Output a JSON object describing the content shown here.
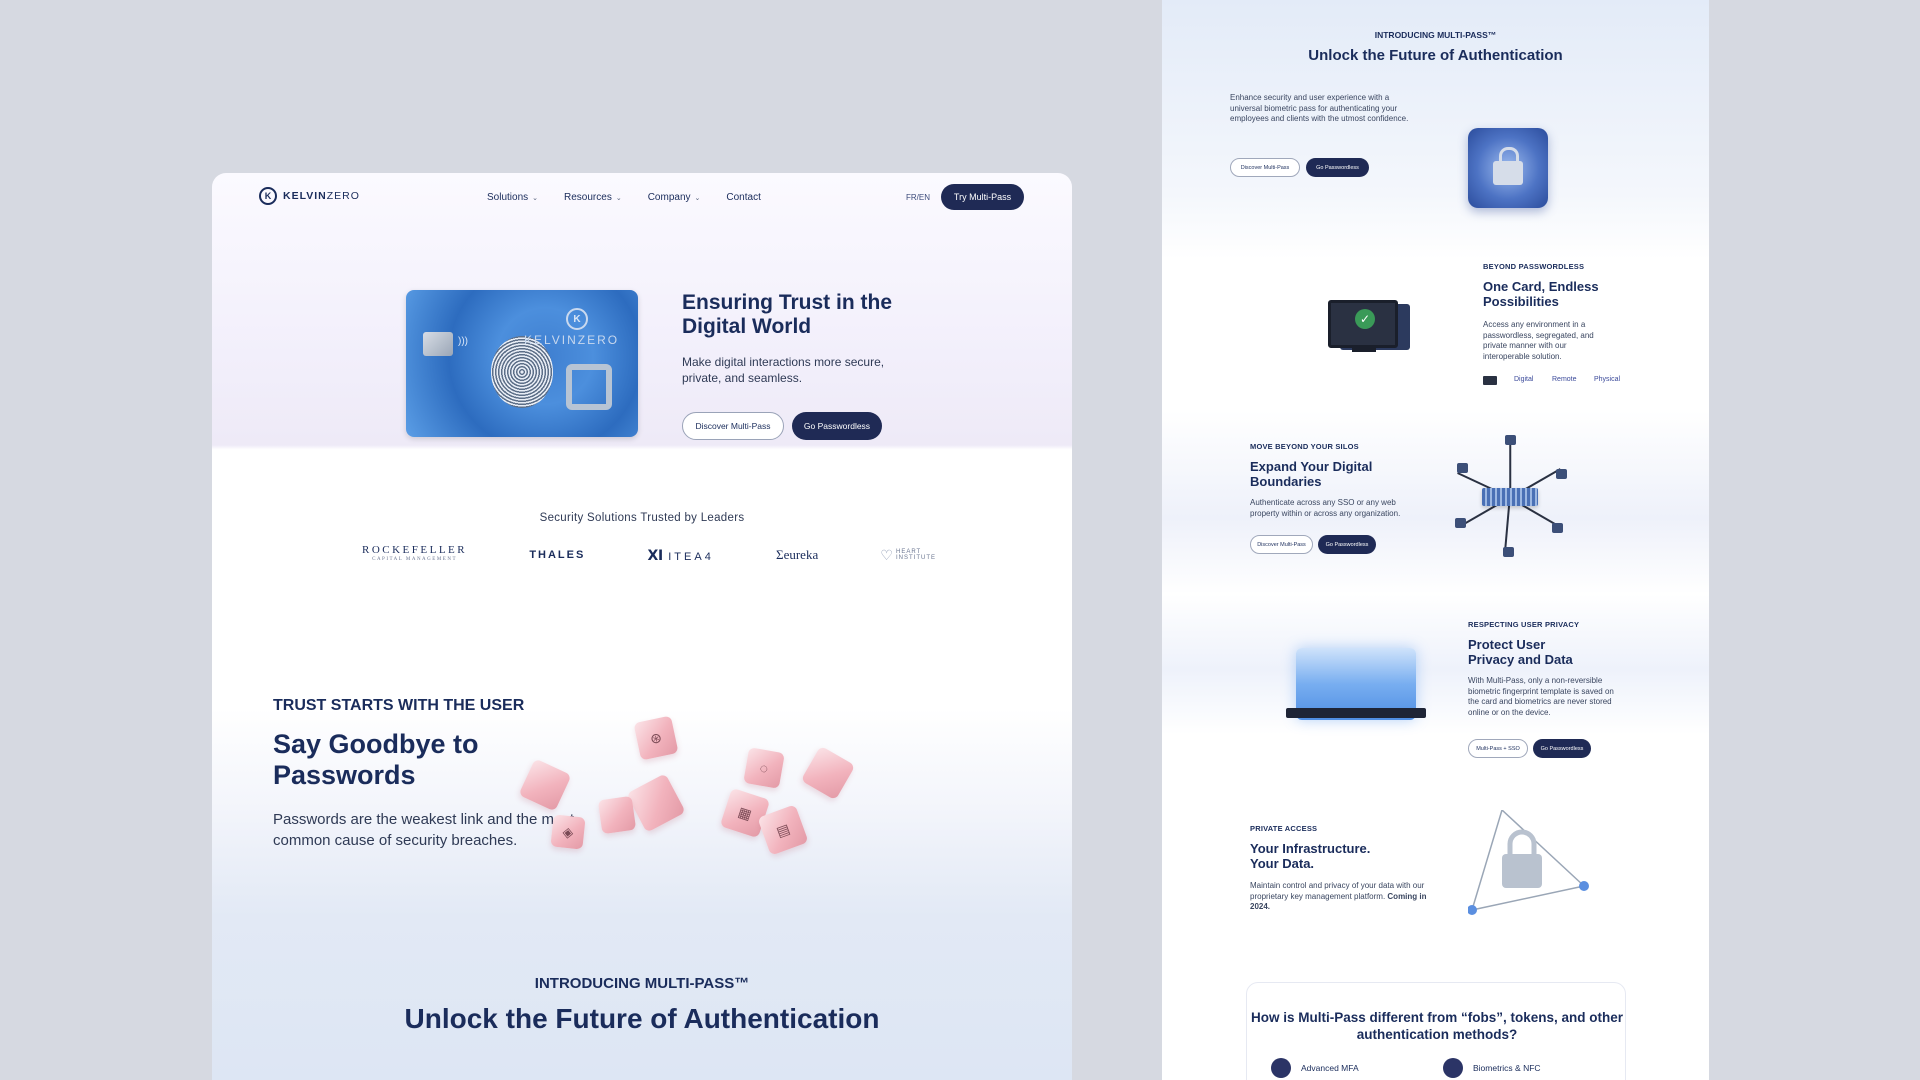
{
  "left": {
    "nav": {
      "logo_k": "K",
      "logo_bold": "KELVIN",
      "logo_light": "ZERO",
      "links": [
        "Solutions",
        "Resources",
        "Company",
        "Contact"
      ],
      "lang": "FR/EN",
      "cta": "Try Multi-Pass"
    },
    "hero": {
      "card_brand": "KELVINZERO",
      "title": "Ensuring Trust in the Digital World",
      "subtitle": "Make digital interactions more secure, private, and seamless.",
      "btn_outline": "Discover Multi-Pass",
      "btn_dark": "Go Passwordless"
    },
    "trusted": {
      "heading": "Security Solutions Trusted by Leaders",
      "logos": [
        "ROCKEFELLER",
        "THALES",
        "ITEA4",
        "Σeureka",
        "HEART INSTITUTE"
      ],
      "rock_sub": "CAPITAL MANAGEMENT"
    },
    "passwords": {
      "eyebrow": "TRUST STARTS WITH THE USER",
      "title": "Say Goodbye to Passwords",
      "subtitle": "Passwords are the weakest link and the most common cause of security breaches."
    },
    "intro": {
      "eyebrow": "INTRODUCING MULTI-PASS™",
      "title": "Unlock the Future of Authentication"
    }
  },
  "right": {
    "eyebrow": "INTRODUCING MULTI-PASS™",
    "title": "Unlock the Future of Authentication",
    "intro_text": "Enhance security and user experience with a universal biometric pass for authenticating your employees and clients with the utmost confidence.",
    "intro_btn_outline": "Discover Multi-Pass",
    "intro_btn_dark": "Go Passwordless",
    "s1": {
      "kicker": "BEYOND PASSWORDLESS",
      "title": "One Card, Endless Possibilities",
      "text": "Access any environment in a passwordless, segregated, and private manner with our interoperable solution.",
      "options": [
        "Digital",
        "Remote",
        "Physical"
      ]
    },
    "s2": {
      "kicker": "MOVE BEYOND YOUR SILOS",
      "title": "Expand Your Digital Boundaries",
      "text": "Authenticate across any SSO or any web property within or across any organization.",
      "btn_outline": "Discover Multi-Pass",
      "btn_dark": "Go Passwordless"
    },
    "s3": {
      "kicker": "RESPECTING USER PRIVACY",
      "title": "Protect User Privacy and Data",
      "text": "With Multi-Pass, only a non-reversible biometric fingerprint template is saved on the card and biometrics are never stored online or on the device.",
      "btn_outline": "Multi-Pass + SSO",
      "btn_dark": "Go Passwordless"
    },
    "s4": {
      "kicker": "PRIVATE ACCESS",
      "title": "Your Infrastructure. Your Data.",
      "text": "Maintain control and privacy of your data with our proprietary key management platform.",
      "text_bold": "Coming in 2024."
    },
    "faq": {
      "title": "How is Multi-Pass different from “fobs”, tokens, and other authentication methods?",
      "items": [
        "Advanced MFA",
        "Biometrics & NFC"
      ]
    }
  }
}
